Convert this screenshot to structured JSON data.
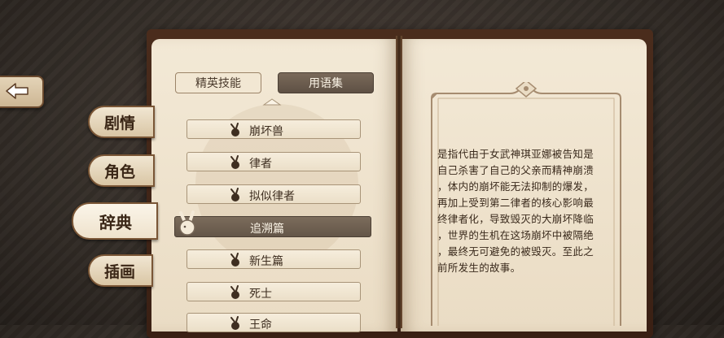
{
  "navigation": {
    "back_icon": "left-arrow-icon",
    "side_tabs": [
      {
        "label": "剧情",
        "active": false
      },
      {
        "label": "角色",
        "active": false
      },
      {
        "label": "辞典",
        "active": true
      },
      {
        "label": "插画",
        "active": false
      }
    ]
  },
  "dictionary": {
    "tabs": [
      {
        "label": "精英技能",
        "active": false
      },
      {
        "label": "用语集",
        "active": true
      }
    ],
    "entries": [
      {
        "label": "崩坏兽",
        "selected": false
      },
      {
        "label": "律者",
        "selected": false
      },
      {
        "label": "拟似律者",
        "selected": false
      },
      {
        "label": "追溯篇",
        "selected": true
      },
      {
        "label": "新生篇",
        "selected": false
      },
      {
        "label": "死士",
        "selected": false
      },
      {
        "label": "王命",
        "selected": false
      }
    ],
    "entry_icon": "bunny-icon"
  },
  "detail": {
    "lines": [
      "是指代由于女武神琪亚娜被告知是",
      "自己杀害了自己的父亲而精神崩溃",
      "，体内的崩坏能无法抑制的爆发，",
      "再加上受到第二律者的核心影响最",
      "终律者化，导致毁灭的大崩坏降临",
      "，世界的生机在这场崩坏中被隔绝",
      "，最终无可避免的被毁灭。至此之",
      "前所发生的故事。"
    ]
  },
  "colors": {
    "book_cover": "#3a2014",
    "page": "#f3e9d6",
    "selected_row": "#645648",
    "text": "#3a2a1c"
  }
}
